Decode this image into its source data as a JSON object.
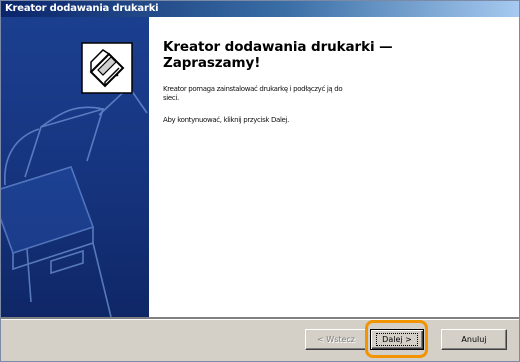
{
  "window": {
    "title": "Kreator dodawania drukarki"
  },
  "main": {
    "heading_line1": "Kreator dodawania drukarki —",
    "heading_line2": "Zapraszamy!",
    "intro_line1": "Kreator pomaga zainstalować drukarkę i podłączyć ją do",
    "intro_line2": "sieci.",
    "instruction": "Aby kontynuować, kliknij przycisk Dalej."
  },
  "buttons": {
    "back_label": "< Wstecz",
    "next_label": "Dalej >",
    "cancel_label": "Anuluj"
  },
  "icons": {
    "wizard": "printer-icon"
  },
  "colors": {
    "side_panel": "#1b3f8f",
    "highlight": "#f29400",
    "title_bar_start": "#0a246a"
  }
}
